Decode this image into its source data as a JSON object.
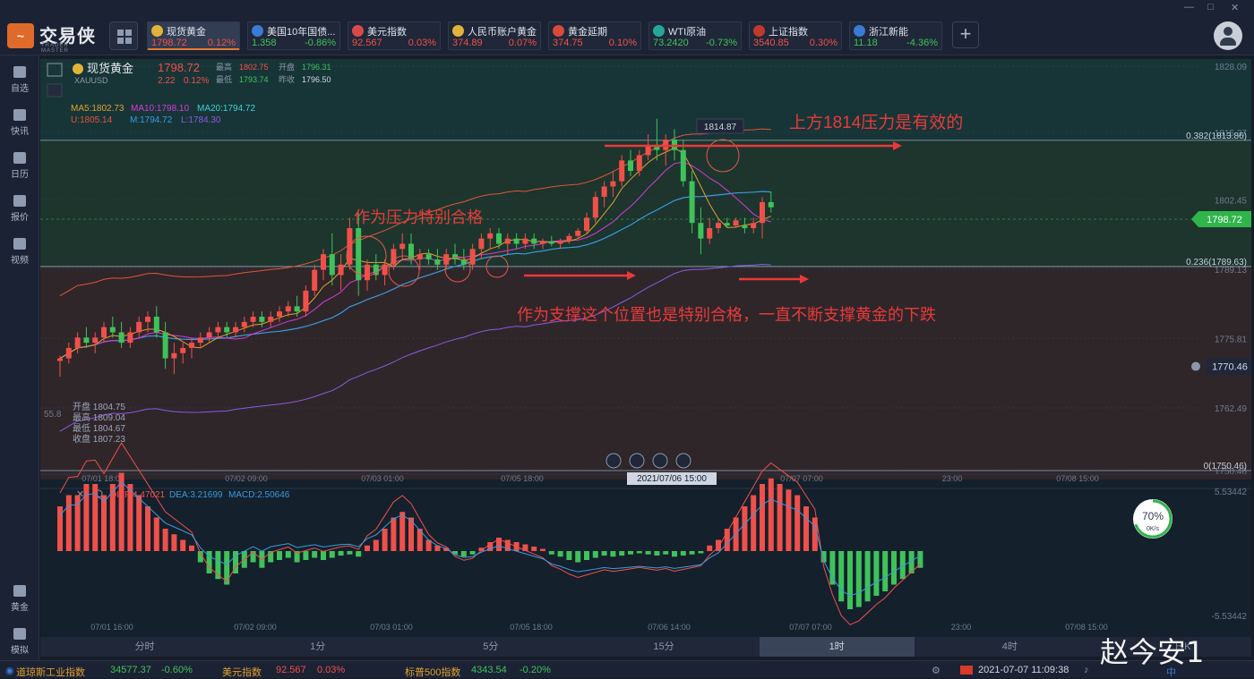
{
  "app": {
    "name": "交易侠",
    "sub": "TRADER MASTER"
  },
  "window_controls": [
    "—",
    "□",
    "✕"
  ],
  "tickers": [
    {
      "name": "现货黄金",
      "price": "1798.72",
      "change": "0.12%",
      "dir": "up",
      "icon": "gold-coin-icon",
      "color": "#e2b33a",
      "active": true
    },
    {
      "name": "美国10年国债...",
      "price": "1.358",
      "change": "-0.86%",
      "dir": "dn",
      "icon": "bar-chart-icon",
      "color": "#3a7bd5"
    },
    {
      "name": "美元指数",
      "price": "92.567",
      "change": "0.03%",
      "dir": "up",
      "icon": "us-flag-icon",
      "color": "#d84a4a"
    },
    {
      "name": "人民币账户黄金",
      "price": "374.89",
      "change": "0.07%",
      "dir": "up",
      "icon": "gold-coin-icon",
      "color": "#e2b33a"
    },
    {
      "name": "黄金延期",
      "price": "374.75",
      "change": "0.10%",
      "dir": "up",
      "icon": "gold-bar-icon",
      "color": "#d84a3a"
    },
    {
      "name": "WTI原油",
      "price": "73.2420",
      "change": "-0.73%",
      "dir": "dn",
      "icon": "oil-icon",
      "color": "#26a69a"
    },
    {
      "name": "上证指数",
      "price": "3540.85",
      "change": "0.30%",
      "dir": "up",
      "icon": "sse-logo-icon",
      "color": "#c0392b"
    },
    {
      "name": "浙江新能",
      "price": "11.18",
      "change": "-4.36%",
      "dir": "dn",
      "icon": "bar-chart-icon",
      "color": "#3a7bd5"
    }
  ],
  "sidebar": {
    "items": [
      {
        "label": "自选",
        "icon": "bookmark-icon"
      },
      {
        "label": "快讯",
        "icon": "news-icon"
      },
      {
        "label": "日历",
        "icon": "calendar-icon"
      },
      {
        "label": "报价",
        "icon": "trend-icon"
      },
      {
        "label": "视频",
        "icon": "play-icon"
      }
    ],
    "bottom_items": [
      {
        "label": "黄金",
        "icon": "gold-grid-icon"
      },
      {
        "label": "模拟",
        "icon": "wallet-icon"
      }
    ]
  },
  "quote": {
    "name": "现货黄金",
    "symbol": "XAUUSD",
    "price": "1798.72",
    "change": "2.22",
    "change_pct": "0.12%",
    "high_label": "最高",
    "high": "1802.75",
    "open_label": "开盘",
    "open": "1796.31",
    "low_label": "最低",
    "low": "1793.74",
    "prev_label": "昨收",
    "prev": "1796.50"
  },
  "indicators": {
    "ma5": "MA5:1802.73",
    "ma10": "MA10:1798.10",
    "ma20": "MA20:1794.72",
    "u": "U:1805.14",
    "m": "M:1794.72",
    "l": "L:1784.30"
  },
  "ohlc_box": {
    "open": "开盘 1804.75",
    "high": "最高 1809.04",
    "low": "最低 1804.67",
    "close": "收盘 1807.23"
  },
  "main_y_ticks": [
    "1828.09",
    "1815.37",
    "1802.45",
    "1789.13",
    "1775.81",
    "1762.49",
    "1750.46"
  ],
  "partial_left_label": "55.8",
  "fib_levels": [
    {
      "label": "0.382(1813.86)",
      "value": 1813.86
    },
    {
      "label": "0.236(1789.63)",
      "value": 1789.63
    },
    {
      "label": "0(1750.46)",
      "value": 1750.46
    }
  ],
  "current_price_tag": "1798.72",
  "alert_price_tag": "1770.46",
  "peak_label": "1814.87",
  "annotations": [
    "上方1814压力是有效的",
    "作为压力特别合格",
    "作为支撑这个位置也是特别合格，一直不断支撑黄金的下跌"
  ],
  "x_ticks_top": [
    "07/01 18:00",
    "07/02 09:00",
    "07/03 01:00",
    "07/05 18:00",
    "07/06 14:00",
    "07/07 07:00",
    "23:00",
    "07/08 15:00"
  ],
  "crosshair_time": "2021/07/06 15:00",
  "macd": {
    "diff": "DIFF:4.47021",
    "dea": "DEA:3.21699",
    "macd": "MACD:2.50646",
    "y_top": "5.53442",
    "y_bottom": "-5.53442",
    "x_ticks": [
      "07/01 16:00",
      "07/02 09:00",
      "07/03 01:00",
      "07/05 18:00",
      "07/06 14:00",
      "07/07 07:00",
      "23:00",
      "07/08 15:00"
    ],
    "hist": [
      4,
      5,
      5,
      6,
      6,
      5,
      6,
      7,
      6,
      5,
      4,
      3,
      2,
      1.5,
      1,
      0.5,
      -1,
      -2,
      -2.5,
      -3,
      -2,
      -1.5,
      -1,
      -1.5,
      -1,
      -0.8,
      -0.6,
      -1,
      -0.8,
      -0.6,
      -0.8,
      -0.6,
      -0.4,
      -0.3,
      -0.5,
      0.5,
      1,
      2,
      3,
      3.5,
      3,
      2,
      1,
      0.5,
      0.3,
      -0.3,
      -0.5,
      -0.3,
      0.3,
      0.8,
      1.2,
      1,
      0.8,
      0.6,
      0.4,
      0.2,
      -0.3,
      -0.5,
      -0.8,
      -1,
      -0.8,
      -0.6,
      -0.4,
      -0.5,
      -0.4,
      -0.3,
      -0.2,
      -0.3,
      -0.4,
      -0.3,
      -0.5,
      -0.4,
      -0.3,
      -0.2,
      0.5,
      1,
      2,
      3,
      4,
      5,
      6,
      6.5,
      6,
      5.5,
      5,
      4,
      3,
      -1,
      -3,
      -4.5,
      -5.2,
      -5,
      -4.5,
      -4,
      -3.6,
      -3,
      -2.5,
      -2,
      -1.5
    ]
  },
  "gauge": {
    "value": 70,
    "text": "70%",
    "sub": "0K/s"
  },
  "periods": [
    "分时",
    "1分",
    "5分",
    "15分",
    "1时",
    "4时",
    "日K"
  ],
  "active_period": "1时",
  "status": [
    {
      "name": "道琼斯工业指数",
      "value": "34577.37",
      "change": "-0.60%",
      "dir": "dn"
    },
    {
      "name": "美元指数",
      "value": "92.567",
      "change": "0.03%",
      "dir": "up"
    },
    {
      "name": "标普500指数",
      "value": "4343.54",
      "change": "-0.20%",
      "dir": "dn"
    }
  ],
  "datetime": "2021-07-07 11:09:38",
  "ime_text": "中",
  "watermark": "赵今安1",
  "chart_data": {
    "type": "candlestick",
    "title": "现货黄金 XAUUSD",
    "timeframe": "1时",
    "ylim": [
      1750.46,
      1828.09
    ],
    "candles": [
      [
        1771.5,
        1772.5,
        1768.5,
        1772
      ],
      [
        1772,
        1775,
        1771,
        1774
      ],
      [
        1774,
        1777,
        1773,
        1776
      ],
      [
        1776,
        1778,
        1774,
        1775
      ],
      [
        1775,
        1777,
        1773,
        1776
      ],
      [
        1776,
        1779,
        1775,
        1778
      ],
      [
        1778,
        1780,
        1776,
        1777
      ],
      [
        1777,
        1779,
        1774,
        1775
      ],
      [
        1775,
        1778,
        1774,
        1777
      ],
      [
        1777,
        1780,
        1776,
        1779
      ],
      [
        1779,
        1781,
        1777,
        1780
      ],
      [
        1780,
        1782,
        1776,
        1777
      ],
      [
        1777,
        1779,
        1770,
        1772
      ],
      [
        1772,
        1775,
        1769,
        1773
      ],
      [
        1773,
        1775,
        1771,
        1774
      ],
      [
        1774,
        1776,
        1772,
        1775
      ],
      [
        1775,
        1777,
        1774,
        1776
      ],
      [
        1776,
        1778,
        1775,
        1777
      ],
      [
        1777,
        1779,
        1776,
        1778
      ],
      [
        1778,
        1779,
        1776,
        1777
      ],
      [
        1777,
        1779,
        1776,
        1778
      ],
      [
        1778,
        1780,
        1777,
        1779
      ],
      [
        1779,
        1781,
        1778,
        1780
      ],
      [
        1780,
        1781,
        1778,
        1779
      ],
      [
        1779,
        1781,
        1778,
        1780
      ],
      [
        1780,
        1782,
        1779,
        1781
      ],
      [
        1781,
        1783,
        1780,
        1782
      ],
      [
        1782,
        1784,
        1780,
        1781
      ],
      [
        1781,
        1786,
        1780,
        1785
      ],
      [
        1785,
        1790,
        1784,
        1789
      ],
      [
        1789,
        1793,
        1787,
        1792
      ],
      [
        1792,
        1796,
        1786,
        1788
      ],
      [
        1788,
        1792,
        1785,
        1790
      ],
      [
        1790,
        1799,
        1789,
        1797
      ],
      [
        1797,
        1800,
        1784,
        1787
      ],
      [
        1787,
        1791,
        1785,
        1790
      ],
      [
        1790,
        1792,
        1787,
        1788
      ],
      [
        1788,
        1791,
        1786,
        1790
      ],
      [
        1790,
        1794,
        1789,
        1793
      ],
      [
        1793,
        1796,
        1791,
        1794
      ],
      [
        1794,
        1796,
        1790,
        1791
      ],
      [
        1791,
        1793,
        1789,
        1792
      ],
      [
        1792,
        1793,
        1790,
        1791
      ],
      [
        1791,
        1793,
        1789,
        1790
      ],
      [
        1790,
        1793,
        1789,
        1792
      ],
      [
        1792,
        1794,
        1790,
        1791
      ],
      [
        1791,
        1793,
        1789,
        1790
      ],
      [
        1790,
        1794,
        1789,
        1793
      ],
      [
        1793,
        1796,
        1791,
        1795
      ],
      [
        1795,
        1797,
        1793,
        1796
      ],
      [
        1796,
        1797,
        1793,
        1794
      ],
      [
        1794,
        1796,
        1792,
        1795
      ],
      [
        1795,
        1796,
        1793,
        1794
      ],
      [
        1794,
        1796,
        1793,
        1795
      ],
      [
        1795,
        1796,
        1793,
        1794
      ],
      [
        1794,
        1795,
        1793,
        1794.5
      ],
      [
        1794.5,
        1795.5,
        1793.5,
        1794
      ],
      [
        1794,
        1795,
        1793,
        1794.5
      ],
      [
        1794.5,
        1796,
        1794,
        1795.5
      ],
      [
        1795.5,
        1797,
        1795,
        1796.5
      ],
      [
        1796.5,
        1800,
        1796,
        1799
      ],
      [
        1799,
        1804,
        1798,
        1803
      ],
      [
        1803,
        1806,
        1801,
        1805
      ],
      [
        1805,
        1808,
        1803,
        1806
      ],
      [
        1806,
        1811,
        1805,
        1810
      ],
      [
        1810,
        1812,
        1807,
        1808
      ],
      [
        1808,
        1812,
        1807,
        1811
      ],
      [
        1811,
        1815,
        1810,
        1813
      ],
      [
        1813,
        1818,
        1810,
        1812
      ],
      [
        1812,
        1815,
        1809,
        1814
      ],
      [
        1814,
        1816,
        1810,
        1812
      ],
      [
        1812,
        1814,
        1805,
        1806
      ],
      [
        1806,
        1808,
        1796,
        1798
      ],
      [
        1798,
        1801,
        1792,
        1795
      ],
      [
        1795,
        1799,
        1794,
        1797
      ],
      [
        1797,
        1799,
        1796,
        1798
      ],
      [
        1798,
        1799,
        1797,
        1797.5
      ],
      [
        1797.5,
        1799,
        1797,
        1798.5
      ],
      [
        1797.5,
        1799,
        1796,
        1797
      ],
      [
        1797,
        1799,
        1796,
        1798
      ],
      [
        1798,
        1803,
        1795,
        1802
      ],
      [
        1802,
        1804,
        1800,
        1801
      ]
    ]
  }
}
